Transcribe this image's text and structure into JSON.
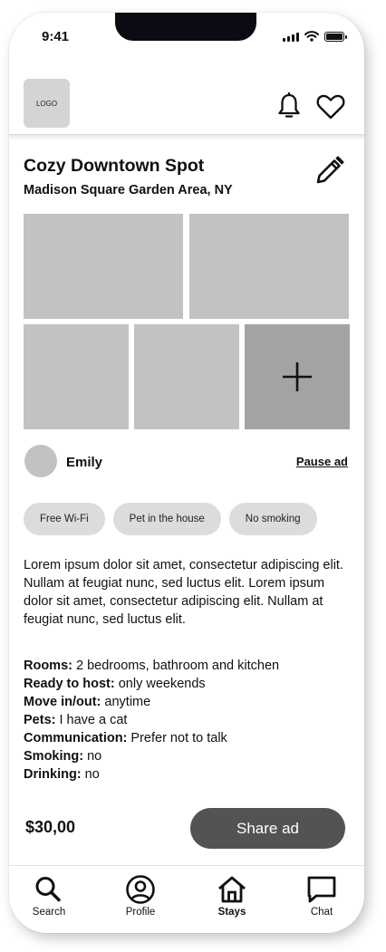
{
  "status_bar": {
    "time": "9:41"
  },
  "header": {
    "logo_text": "LOGO"
  },
  "listing": {
    "title": "Cozy Downtown Spot",
    "location": "Madison Square Garden Area, NY"
  },
  "host": {
    "name": "Emily",
    "pause_label": "Pause ad"
  },
  "tags": [
    "Free Wi-Fi",
    "Pet in the house",
    "No smoking"
  ],
  "description": "Lorem ipsum dolor sit amet, consectetur adipiscing elit. Nullam at feugiat nunc, sed luctus elit. Lorem ipsum dolor sit amet, consectetur adipiscing elit. Nullam at feugiat nunc, sed luctus elit.",
  "details": [
    {
      "label": "Rooms:",
      "value": "2 bedrooms, bathroom and kitchen"
    },
    {
      "label": "Ready to host:",
      "value": "only weekends"
    },
    {
      "label": "Move in/out:",
      "value": "anytime"
    },
    {
      "label": "Pets:",
      "value": "I have a cat"
    },
    {
      "label": "Communication:",
      "value": "Prefer not to talk"
    },
    {
      "label": "Smoking:",
      "value": "no"
    },
    {
      "label": "Drinking:",
      "value": "no"
    }
  ],
  "footer": {
    "price": "$30,00",
    "share_label": "Share ad"
  },
  "tabbar": [
    {
      "label": "Search",
      "icon": "search-icon"
    },
    {
      "label": "Profile",
      "icon": "profile-icon"
    },
    {
      "label": "Stays",
      "icon": "home-icon",
      "active": true
    },
    {
      "label": "Chat",
      "icon": "chat-icon"
    }
  ],
  "colors": {
    "photo_placeholder": "#c2c2c2",
    "add_photo_tile": "#a4a2a2",
    "share_button": "#535353",
    "tag_background": "#dcdcdc"
  }
}
